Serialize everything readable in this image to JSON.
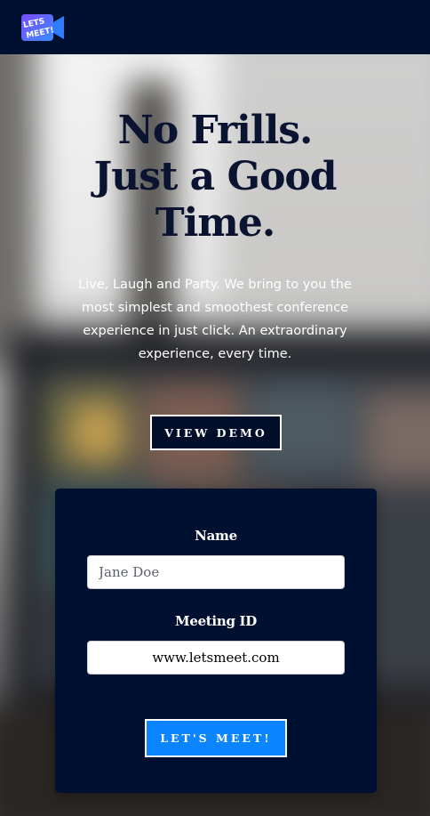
{
  "header": {
    "logo_text": "LETS MEET!"
  },
  "hero": {
    "headline": [
      "No Frills.",
      "Just a Good",
      "Time."
    ],
    "subtext": "Live, Laugh and Party. We bring to you the most simplest and smoothest conference experience in just click. An extraordinary experience, every time.",
    "demo_button": "VIEW DEMO"
  },
  "form": {
    "name_label": "Name",
    "name_placeholder": "Jane Doe",
    "meeting_label": "Meeting ID",
    "meeting_placeholder": "www.letsmeet.com",
    "submit_label": "LET'S MEET!"
  },
  "colors": {
    "navbar": "#001030",
    "headline": "#0a1330",
    "card": "#001030",
    "submit_button": "#0a84ff"
  },
  "icons": {
    "logo": "video-camera-logo-icon"
  }
}
